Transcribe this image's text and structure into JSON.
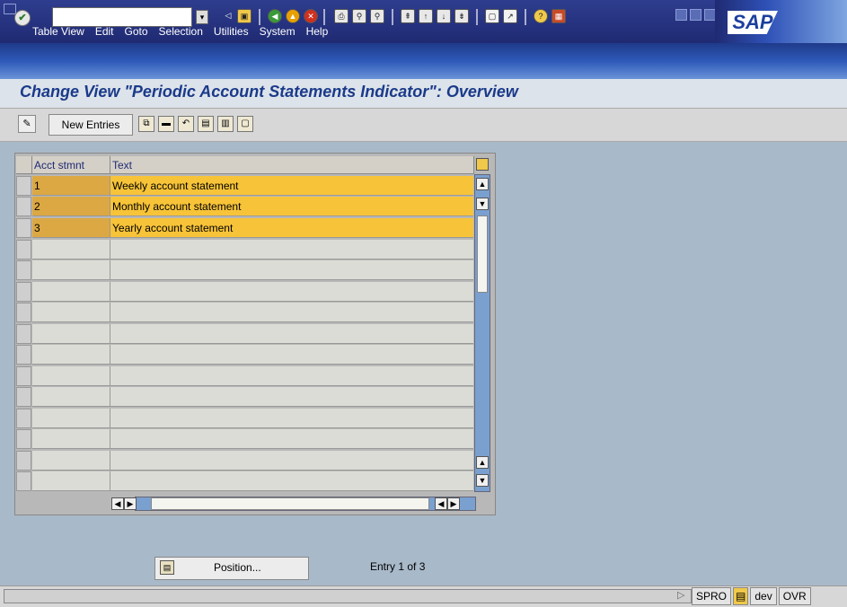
{
  "menubar": {
    "items": [
      "Table View",
      "Edit",
      "Goto",
      "Selection",
      "Utilities",
      "System",
      "Help"
    ],
    "brand": "SAP"
  },
  "toolbar": {
    "ok_label": "✔",
    "command_value": ""
  },
  "title": "Change View \"Periodic Account Statements Indicator\": Overview",
  "app_toolbar": {
    "new_entries_label": "New Entries"
  },
  "table": {
    "columns": [
      "Acct stmnt",
      "Text"
    ],
    "rows": [
      {
        "code": "1",
        "text": "Weekly account statement"
      },
      {
        "code": "2",
        "text": "Monthly account statement"
      },
      {
        "code": "3",
        "text": "Yearly account statement"
      }
    ]
  },
  "footer": {
    "position_label": "Position...",
    "entry_text": "Entry 1 of 3"
  },
  "statusbar": {
    "transaction": "SPRO",
    "client": "dev",
    "mode": "OVR"
  },
  "colors": {
    "menubar": "#2f3d8f",
    "title": "#1a3a8a",
    "row_highlight": "#f7c338",
    "row_key": "#dca843",
    "background": "#a8b9c9"
  }
}
